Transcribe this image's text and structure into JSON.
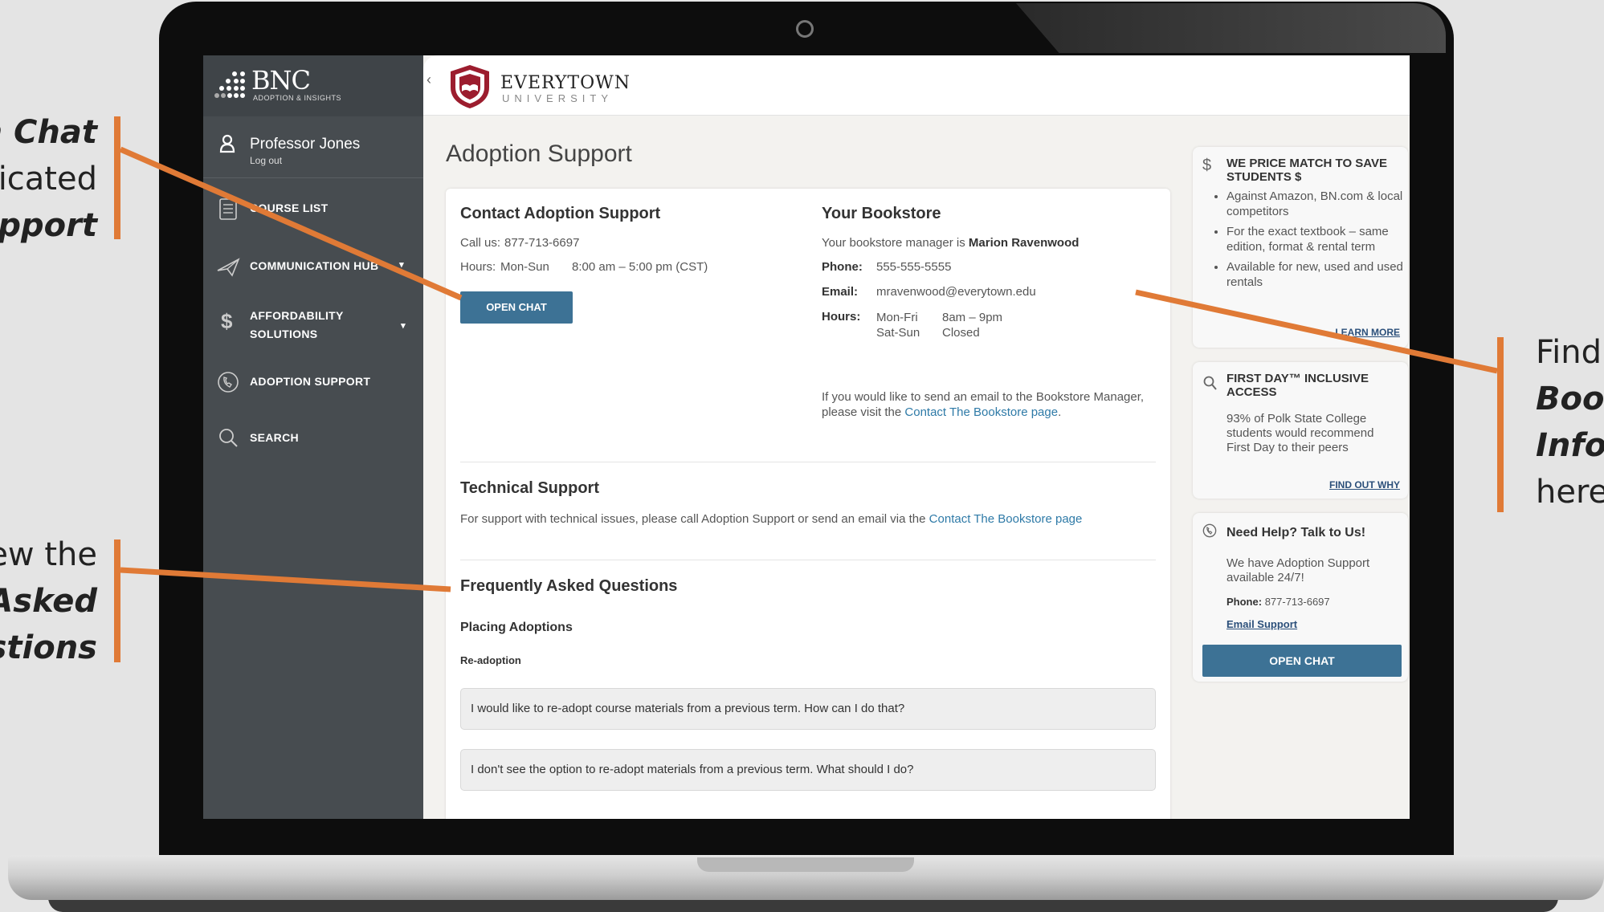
{
  "callouts": {
    "left_top": {
      "line1": "n Chat",
      "line2": "licated",
      "line3": "upport"
    },
    "left_bottom": {
      "line1": "ew the",
      "line2": "Asked",
      "line3": "estions"
    },
    "right": {
      "line1": "Find",
      "line2": "Bool",
      "line3": "Infor",
      "line4": "here"
    }
  },
  "sidebar": {
    "brand": "BNC",
    "brand_sub": "ADOPTION & INSIGHTS",
    "collapse_icon": "chevron-left-icon",
    "user_name": "Professor Jones",
    "logout": "Log out",
    "items": [
      {
        "label": "COURSE LIST",
        "icon": "clipboard-icon"
      },
      {
        "label": "COMMUNICATION HUB",
        "icon": "paper-plane-icon",
        "caret": "▾"
      },
      {
        "label_line1": "AFFORDABILITY",
        "label_line2": "SOLUTIONS",
        "icon": "dollar-icon",
        "caret": "▾"
      },
      {
        "label": "ADOPTION SUPPORT",
        "icon": "phone-icon"
      },
      {
        "label": "SEARCH",
        "icon": "search-icon"
      }
    ]
  },
  "header": {
    "logo_name": "EVERYTOWN",
    "logo_sub": "UNIVERSITY"
  },
  "main": {
    "title": "Adoption Support",
    "contact": {
      "heading": "Contact Adoption Support",
      "call_label": "Call us:",
      "call_value": "877-713-6697",
      "hours_label": "Hours:",
      "hours_days": "Mon-Sun",
      "hours_time": "8:00 am – 5:00 pm (CST)",
      "button": "OPEN CHAT"
    },
    "bookstore": {
      "heading": "Your Bookstore",
      "manager_prefix": "Your bookstore manager is",
      "manager_name": "Marion Ravenwood",
      "phone_label": "Phone:",
      "phone_value": "555-555-5555",
      "email_label": "Email:",
      "email_value": "mravenwood@everytown.edu",
      "hours_label": "Hours:",
      "hours_row1_days": "Mon-Fri",
      "hours_row1_time": "8am – 9pm",
      "hours_row2_days": "Sat-Sun",
      "hours_row2_time": "Closed",
      "note_prefix": "If you would like to send an email to the Bookstore Manager, please visit the",
      "note_link": "Contact The Bookstore page",
      "note_suffix": "."
    },
    "technical": {
      "heading": "Technical Support",
      "text": "For support with technical issues, please call Adoption Support or send an email via the",
      "link": "Contact The Bookstore page"
    },
    "faq": {
      "heading": "Frequently Asked Questions",
      "section": "Placing Adoptions",
      "subsection": "Re-adoption",
      "items": [
        "I would like to re-adopt course materials from a previous term. How can I do that?",
        "I don't see the option to re-adopt materials from a previous term. What should I do?"
      ]
    }
  },
  "rail": {
    "price_match": {
      "icon": "dollar-icon",
      "title": "WE PRICE MATCH TO SAVE STUDENTS $",
      "bullets": [
        "Against Amazon, BN.com & local competitors",
        "For the exact textbook – same edition, format & rental term",
        "Available for new, used and used rentals"
      ],
      "link": "LEARN MORE"
    },
    "first_day": {
      "icon": "search-icon",
      "title": "FIRST DAY™ INCLUSIVE ACCESS",
      "body": "93% of Polk State College students would recommend First Day to their peers",
      "link": "FIND OUT WHY"
    },
    "help": {
      "icon": "phone-icon",
      "title": "Need Help? Talk to Us!",
      "body": "We have Adoption Support available 24/7!",
      "phone_label": "Phone:",
      "phone_value": "877-713-6697",
      "email_link": "Email Support",
      "button": "OPEN CHAT"
    }
  },
  "colors": {
    "accent_orange": "#e07a36",
    "button_blue": "#3d7295",
    "sidebar": "#474c50",
    "brand_red": "#9c1d2e"
  }
}
